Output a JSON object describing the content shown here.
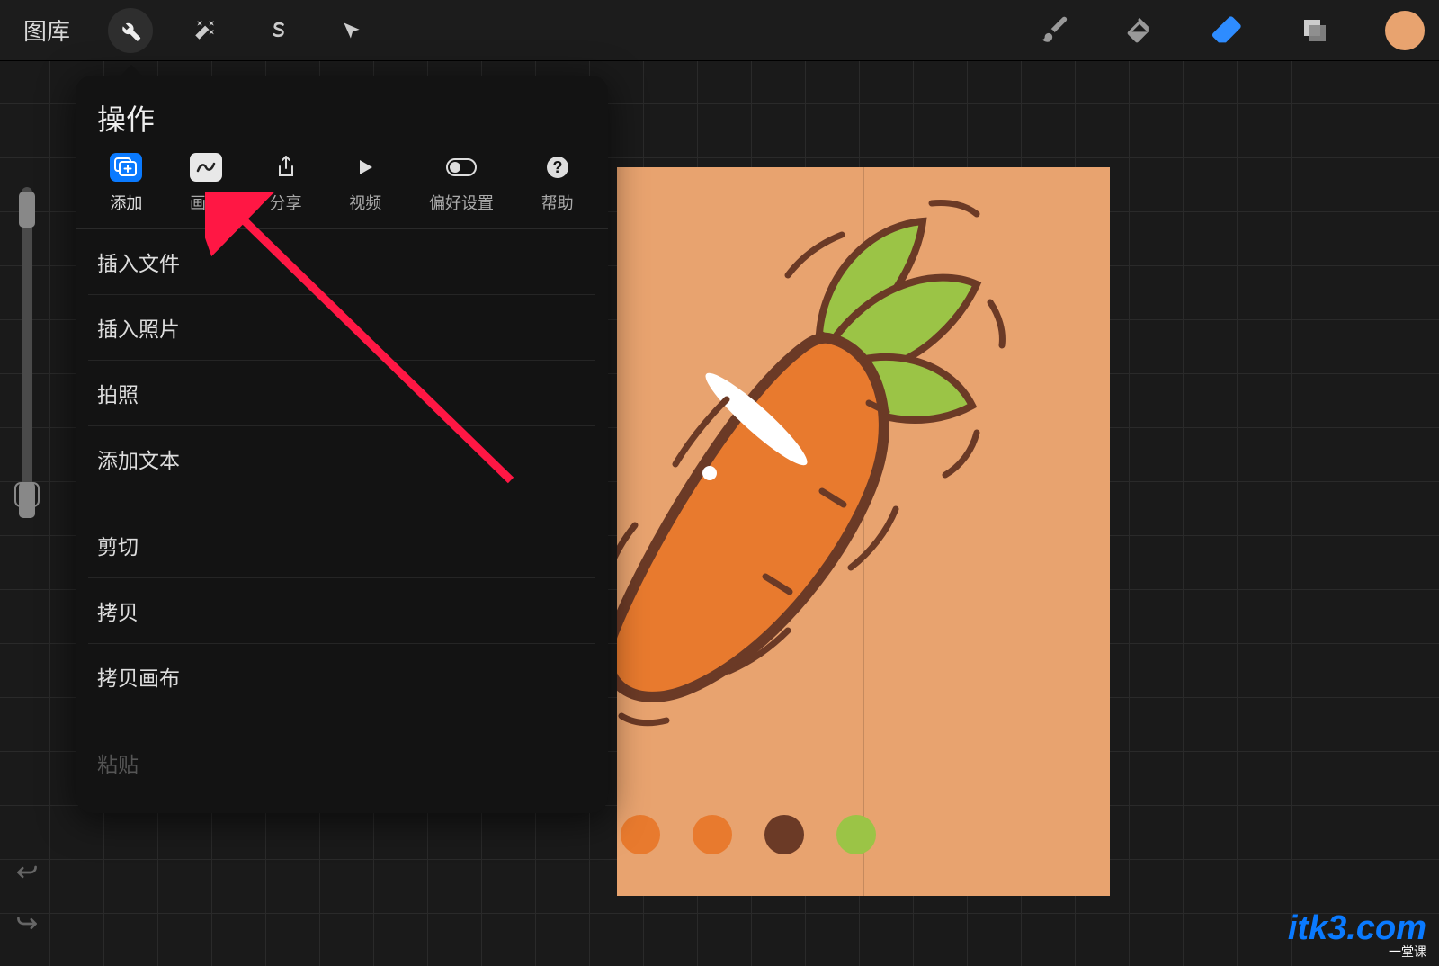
{
  "topbar": {
    "gallery": "图库"
  },
  "popup": {
    "title": "操作",
    "tabs": [
      {
        "label": "添加",
        "key": "add"
      },
      {
        "label": "画布",
        "key": "canvas"
      },
      {
        "label": "分享",
        "key": "share"
      },
      {
        "label": "视频",
        "key": "video"
      },
      {
        "label": "偏好设置",
        "key": "prefs"
      },
      {
        "label": "帮助",
        "key": "help"
      }
    ],
    "items_group1": [
      "插入文件",
      "插入照片",
      "拍照",
      "添加文本"
    ],
    "items_group2": [
      "剪切",
      "拷贝",
      "拷贝画布"
    ],
    "paste": "粘贴"
  },
  "colors": {
    "accent": "#0a7aff",
    "canvas_bg": "#e8a36f",
    "eraser": "#2e8cff",
    "palette": [
      "#e87a2e",
      "#e87a2e",
      "#6b3a26",
      "#9bc446"
    ],
    "arrow": "#ff1744"
  },
  "watermark": {
    "text": "itk3.com",
    "sub": "一堂课"
  }
}
